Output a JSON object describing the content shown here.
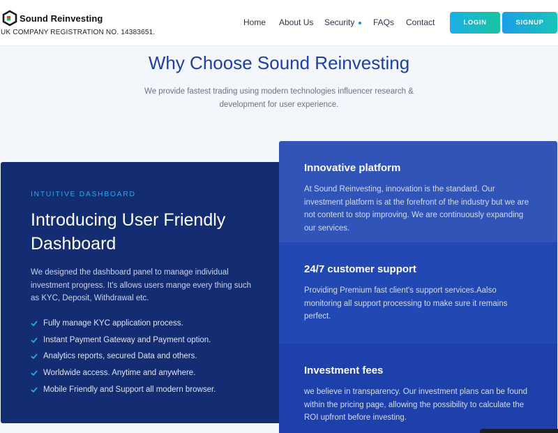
{
  "brand": {
    "name": "Sound Reinvesting",
    "registration": "UK COMPANY REGISTRATION NO. 14383651.",
    "colors": {
      "logo_dark": "#1a1a1a",
      "logo_red": "#e63a2e",
      "logo_green": "#2fb34a"
    }
  },
  "nav": {
    "items": [
      {
        "label": "Home"
      },
      {
        "label": "About Us"
      },
      {
        "label": "Security"
      },
      {
        "label": "FAQs"
      },
      {
        "label": "Contact"
      }
    ],
    "login_label": "LOGIN",
    "signup_label": "SIGNUP"
  },
  "hero": {
    "title": "Why Choose Sound Reinvesting",
    "subtitle": "We provide fastest trading using modern technologies influencer research & development for user experience."
  },
  "dashboard": {
    "kicker": "INTUITIVE DASHBOARD",
    "title": "Introducing User Friendly Dashboard",
    "description": "We designed the dashboard panel to manage individual investment progress. It's allows users mange every thing such as KYC, Deposit, Withdrawal etc.",
    "features": [
      "Fully manage KYC application process.",
      "Instant Payment Gateway and Payment option.",
      "Analytics reports, secured Data and others.",
      "Worldwide access. Anytime and anywhere.",
      "Mobile Friendly and Support all modern browser."
    ],
    "check_icon": "check-icon",
    "accent_color": "#28a9e8"
  },
  "cards": [
    {
      "title": "Innovative platform",
      "text": "At Sound Reinvesting, innovation is the standard. Our investment platform is at the forefront of the industry but we are not content to stop improving. We are continuously expanding our services."
    },
    {
      "title": "24/7 customer support",
      "text": "Providing Premium fast client's support services.Aalso monitoring all support processing to make sure it remains perfect."
    },
    {
      "title": "Investment fees",
      "text": "we believe in transparency. Our investment plans can be found within the pricing page, allowing the possibility to calculate the ROI upfront before investing."
    }
  ]
}
